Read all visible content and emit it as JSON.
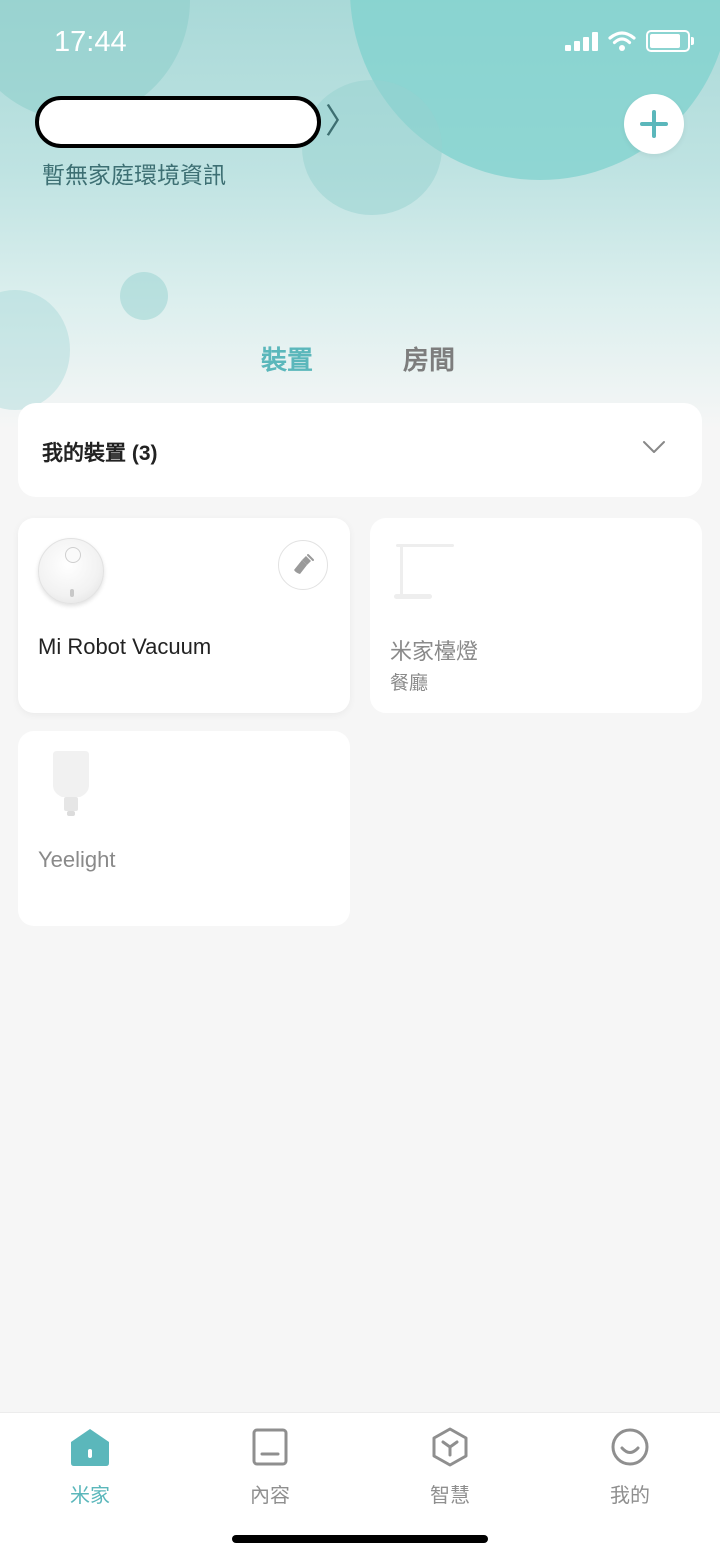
{
  "status_bar": {
    "time": "17:44",
    "icons": [
      "signal-icon",
      "wifi-icon",
      "battery-icon"
    ]
  },
  "header": {
    "home_name": "",
    "env_info": "暫無家庭環境資訊"
  },
  "tabs": [
    {
      "label": "裝置",
      "active": true
    },
    {
      "label": "房間",
      "active": false
    }
  ],
  "device_group": {
    "title": "我的裝置 (3)"
  },
  "devices": [
    {
      "name": "Mi Robot Vacuum",
      "room": "",
      "online": true,
      "icon": "robot-vacuum-icon",
      "action_icon": "broom-icon"
    },
    {
      "name": "米家檯燈",
      "room": "餐廳",
      "online": false,
      "icon": "desk-lamp-icon"
    },
    {
      "name": "Yeelight",
      "room": "",
      "online": false,
      "icon": "light-bulb-icon"
    }
  ],
  "bottom_nav": [
    {
      "label": "米家",
      "icon": "home-icon",
      "active": true
    },
    {
      "label": "內容",
      "icon": "content-icon",
      "active": false
    },
    {
      "label": "智慧",
      "icon": "smart-cube-icon",
      "active": false
    },
    {
      "label": "我的",
      "icon": "profile-smile-icon",
      "active": false
    }
  ],
  "colors": {
    "accent": "#5bb7bb",
    "header_bg": "#a9d9d8",
    "background": "#f6f6f6"
  }
}
